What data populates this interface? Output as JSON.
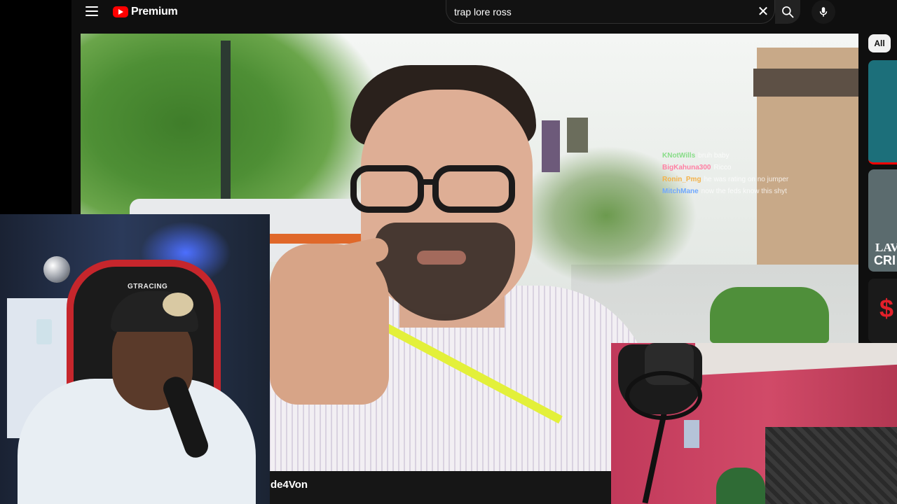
{
  "youtube": {
    "brand": "Premium",
    "search": {
      "value": "trap lore ross"
    },
    "chips": {
      "all": "All"
    },
    "rail": {
      "thumb2_line1": "LAV",
      "thumb2_line2": "CRI",
      "thumb3_text": "$"
    }
  },
  "video": {
    "caption": "de4Von"
  },
  "chat": [
    {
      "user": "KNotWills",
      "message": "bruh baby",
      "color": "#88dd88"
    },
    {
      "user": "BigKahuna300",
      "message": "Ricco",
      "color": "#ff7fa3"
    },
    {
      "user": "Ronin_Pmg",
      "message": "he was rating on no jumper",
      "color": "#f4b24a"
    },
    {
      "user": "MitchMane",
      "message": "now the feds know this shyt",
      "color": "#6fa8ff"
    }
  ],
  "webcam_left": {
    "chair_brand": "GTRACING"
  },
  "icons": {
    "menu": "hamburger-menu-icon",
    "logo": "youtube-play-logo-icon",
    "clear": "close-icon",
    "search": "search-icon",
    "mic": "microphone-icon"
  },
  "colors": {
    "youtube_red": "#ff0000",
    "background": "#0f0f0f",
    "lanyard": "#e3f03a",
    "chair_red": "#c6262c",
    "wall_pink": "#c13a5b"
  }
}
